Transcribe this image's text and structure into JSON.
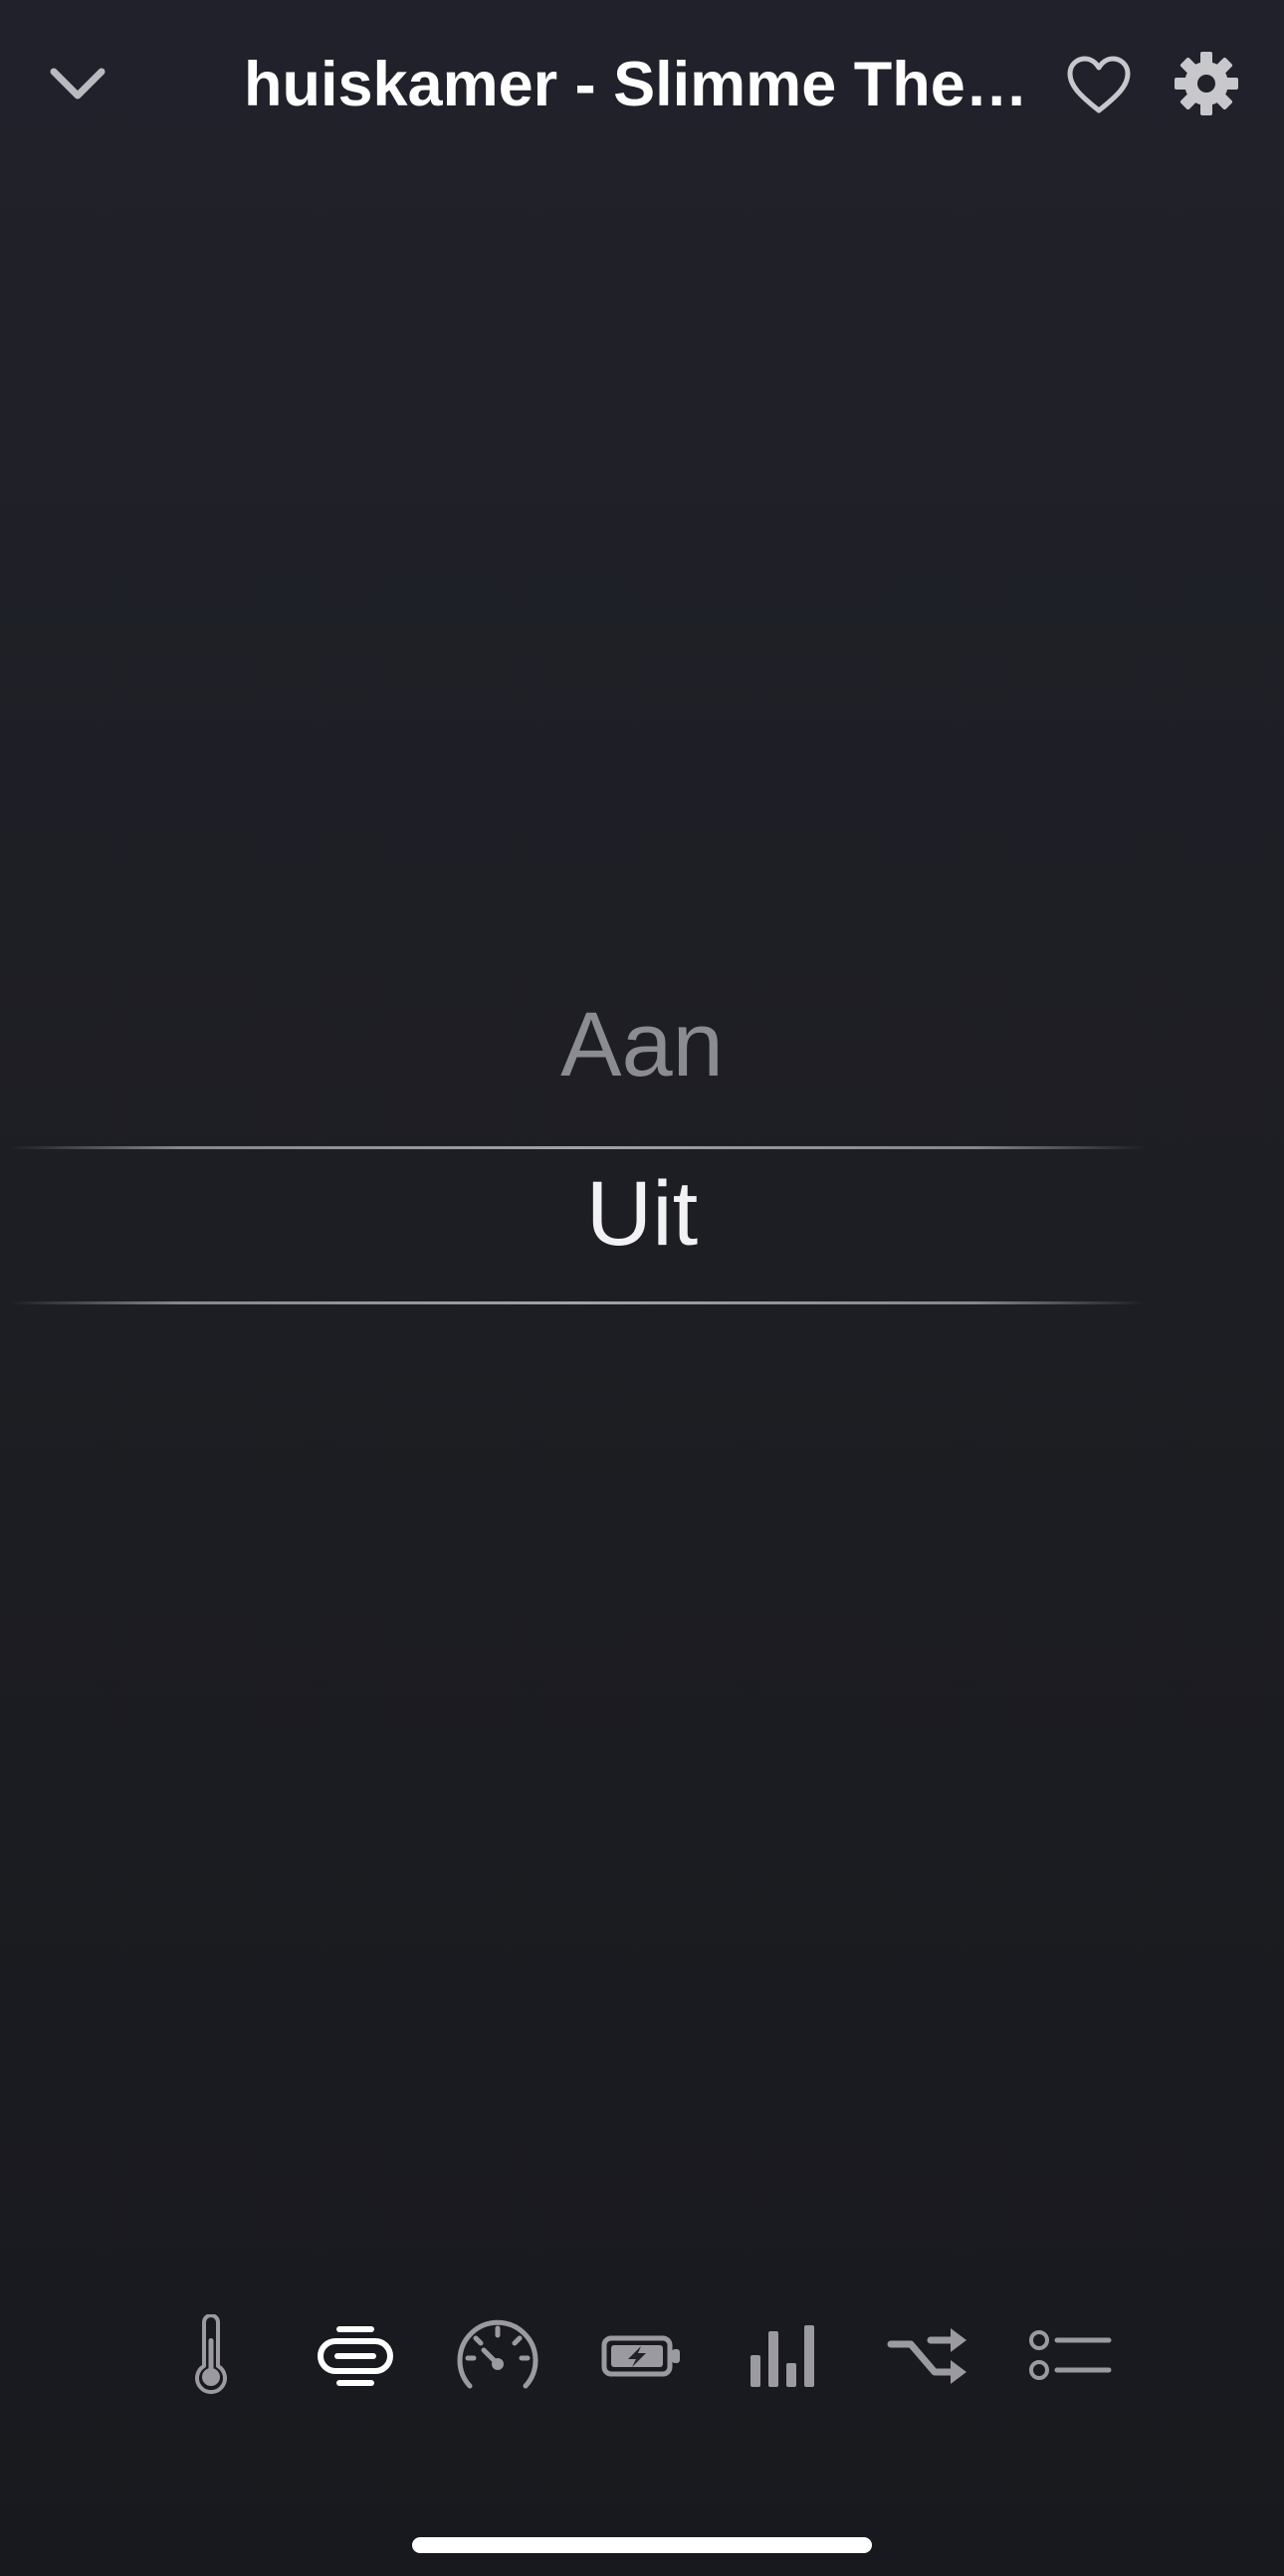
{
  "header": {
    "title": "huiskamer - Slimme Thermostaat",
    "back_icon": "chevron-down-icon",
    "favorite_icon": "heart-icon",
    "settings_icon": "gear-icon"
  },
  "picker": {
    "options": [
      {
        "label": "Aan",
        "selected": false
      },
      {
        "label": "Uit",
        "selected": true
      }
    ]
  },
  "tabs": [
    {
      "icon": "thermometer-icon",
      "active": false
    },
    {
      "icon": "mode-switch-icon",
      "active": true
    },
    {
      "icon": "gauge-icon",
      "active": false
    },
    {
      "icon": "battery-charging-icon",
      "active": false
    },
    {
      "icon": "bar-chart-icon",
      "active": false
    },
    {
      "icon": "shuffle-icon",
      "active": false
    },
    {
      "icon": "list-icon",
      "active": false
    }
  ],
  "colors": {
    "background": "#1d1e23",
    "text_primary": "#f2f2f4",
    "text_secondary": "#8b8c92",
    "icon_inactive": "#9a9aa0",
    "icon_active": "#ffffff"
  }
}
